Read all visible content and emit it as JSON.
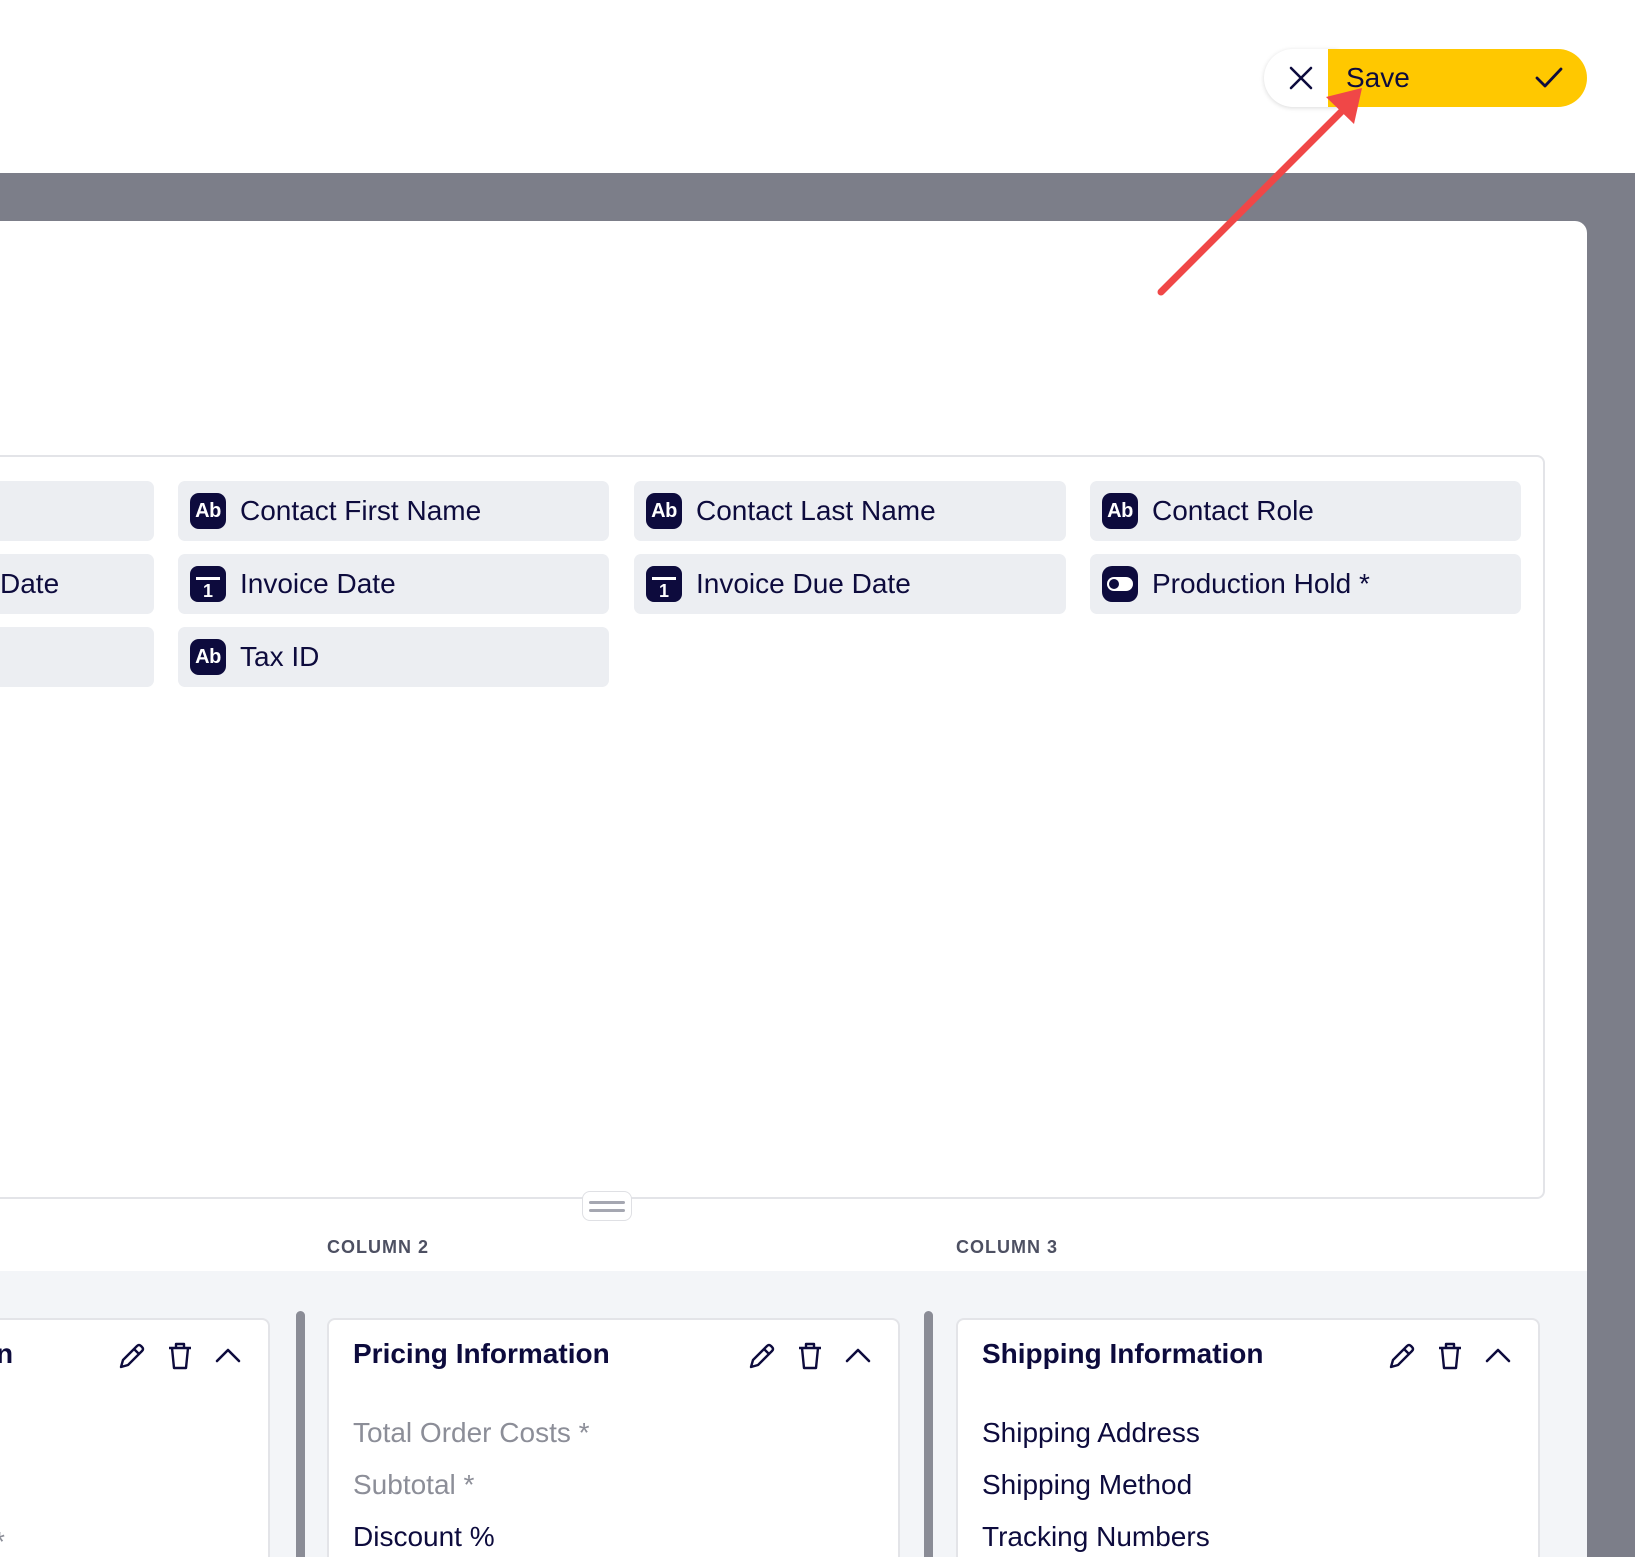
{
  "toolbar": {
    "save_label": "Save"
  },
  "fields": {
    "partial_col0_row2": "Date",
    "contact_first_name": "Contact First Name",
    "contact_last_name": "Contact Last Name",
    "contact_role": "Contact Role",
    "invoice_date": "Invoice Date",
    "invoice_due_date": "Invoice Due Date",
    "production_hold": "Production Hold *",
    "tax_id": "Tax ID",
    "calendar_icon_day": "1",
    "text_icon_label": "Ab"
  },
  "columns": {
    "column2_label": "COLUMN 2",
    "column3_label": "COLUMN 3"
  },
  "cards": {
    "partial_card_title": "n",
    "partial_card_item": "*",
    "pricing": {
      "title": "Pricing Information",
      "items": [
        "Total Order Costs *",
        "Subtotal *",
        "Discount %"
      ]
    },
    "shipping": {
      "title": "Shipping Information",
      "items": [
        "Shipping Address",
        "Shipping Method",
        "Tracking Numbers"
      ]
    }
  },
  "colors": {
    "accent": "#ffc800",
    "navy": "#0d0b3d",
    "backdrop": "#7c7e89",
    "annotation_arrow": "#f04747"
  }
}
